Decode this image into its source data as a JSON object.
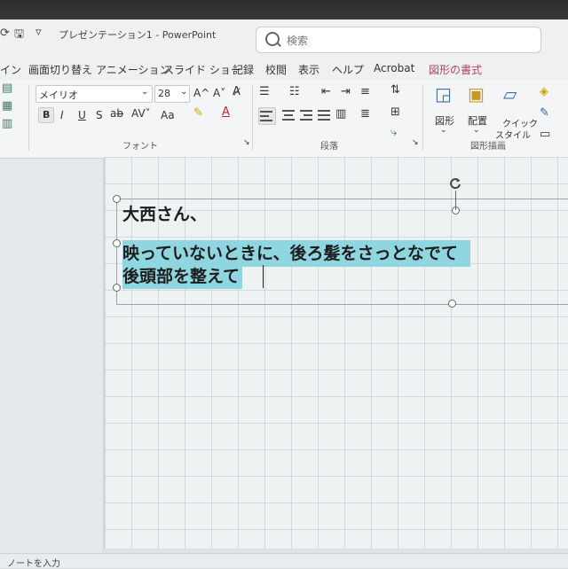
{
  "title_bar": {
    "app_title": "プレゼンテーション1 - PowerPoint",
    "search_placeholder": "検索"
  },
  "menu_tabs": [
    {
      "label": "イン"
    },
    {
      "label": "画面切り替え"
    },
    {
      "label": "アニメーション"
    },
    {
      "label": "スライド ショー"
    },
    {
      "label": "記録"
    },
    {
      "label": "校閲"
    },
    {
      "label": "表示"
    },
    {
      "label": "ヘルプ"
    },
    {
      "label": "Acrobat"
    },
    {
      "label": "図形の書式"
    }
  ],
  "font_group": {
    "font_name": "メイリオ",
    "font_size": "28",
    "grow_label": "A^",
    "shrink_label": "A˅",
    "group_label": "フォント",
    "bold": "B",
    "italic": "I",
    "underline": "U",
    "strike": "S",
    "case_label": "Aa"
  },
  "paragraph_group": {
    "group_label": "段落"
  },
  "drawing_group": {
    "group_label": "図形描画",
    "shapes_label": "図形",
    "arrange_label": "配置",
    "quick_styles_label_1": "クイック",
    "quick_styles_label_2": "スタイル"
  },
  "slide": {
    "lines": [
      "大西さん、",
      "映っていないときに、後ろ髪をさっとなでて",
      "後頭部を整えて"
    ]
  },
  "status_bar": {
    "notes_label": "ノートを入力"
  },
  "colors": {
    "selection_highlight": "#8fd6e0",
    "shape_format_tab": "#b2465f"
  }
}
